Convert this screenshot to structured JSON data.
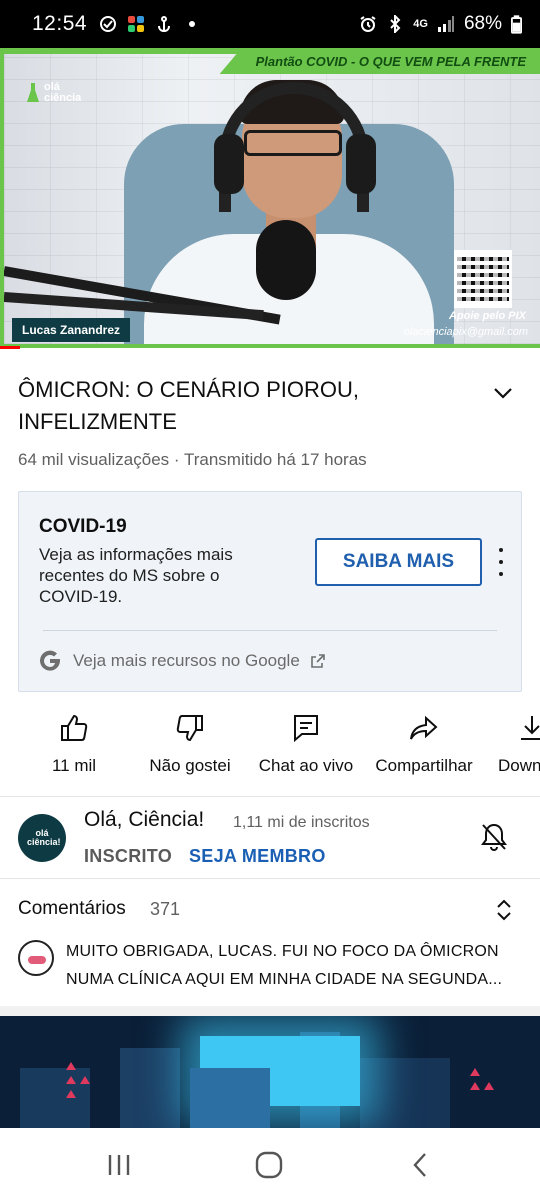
{
  "status_bar": {
    "time": "12:54",
    "network": "4G",
    "battery": "68%"
  },
  "video": {
    "banner": "Plantão COVID - O QUE VEM PELA FRENTE",
    "logo_text": "olá ciência",
    "presenter": "Lucas Zanandrez",
    "pix_label": "Apoie pelo PIX",
    "email": "olacienciapix@gmail.com",
    "progress_color": "#ff0000",
    "accent_color": "#6ac54a"
  },
  "title": "ÔMICRON: O CENÁRIO PIOROU, INFELIZMENTE",
  "meta": "64 mil visualizações · Transmitido há 17 horas",
  "info_panel": {
    "heading": "COVID-19",
    "description": "Veja as informações mais recentes do MS sobre o COVID-19.",
    "button": "SAIBA MAIS",
    "google_link": "Veja mais recursos no Google"
  },
  "actions": {
    "like": "11 mil",
    "dislike": "Não gostei",
    "chat": "Chat ao vivo",
    "share": "Compartilhar",
    "download": "Download"
  },
  "channel": {
    "avatar_text": "olá ciência!",
    "name": "Olá, Ciência!",
    "subscribers": "1,11 mi de inscritos",
    "subscribed_label": "INSCRITO",
    "member_label": "SEJA MEMBRO",
    "member_color": "#1a5fb4"
  },
  "comments": {
    "title": "Comentários",
    "count": "371",
    "preview_line1": "MUITO OBRIGADA, LUCAS. FUI NO FOCO DA ÔMICRON",
    "preview_line2": "NUMA CLÍNICA AQUI EM MINHA CIDADE NA SEGUNDA..."
  },
  "icons": {
    "expand": "chevron-down-icon",
    "like": "thumbs-up-icon",
    "dislike": "thumbs-down-icon",
    "chat": "chat-bubble-icon",
    "share": "share-arrow-icon",
    "download": "download-icon",
    "bell": "bell-off-icon",
    "sort": "sort-icon",
    "google": "google-g-icon",
    "external": "external-link-icon"
  }
}
